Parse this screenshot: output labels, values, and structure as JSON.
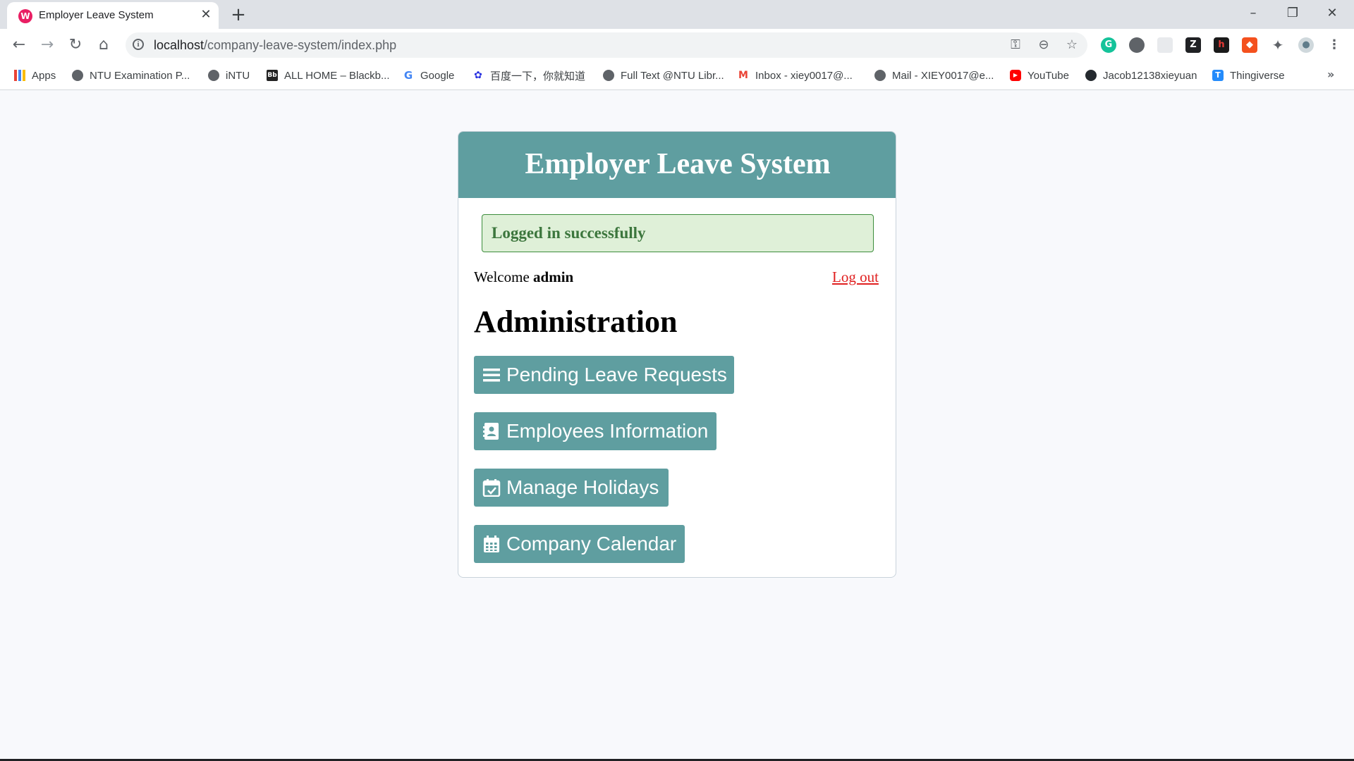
{
  "browser": {
    "tab_title": "Employer Leave System",
    "tab_favicon": "W",
    "url_host": "localhost",
    "url_path": "/company-leave-system/index.php",
    "bookmarks": [
      {
        "label": "Apps",
        "icon": "apps-grid-icon"
      },
      {
        "label": "NTU Examination P...",
        "icon": "globe-icon"
      },
      {
        "label": "iNTU",
        "icon": "globe-icon"
      },
      {
        "label": "ALL HOME – Blackb...",
        "icon": "blackboard-icon"
      },
      {
        "label": "Google",
        "icon": "google-icon"
      },
      {
        "label": "百度一下，你就知道",
        "icon": "baidu-icon"
      },
      {
        "label": "Full Text @NTU Libr...",
        "icon": "globe-icon"
      },
      {
        "label": "Inbox - xiey0017@...",
        "icon": "gmail-icon"
      },
      {
        "label": "Mail - XIEY0017@e...",
        "icon": "globe-icon"
      },
      {
        "label": "YouTube",
        "icon": "youtube-icon"
      },
      {
        "label": "Jacob12138xieyuan",
        "icon": "github-icon"
      },
      {
        "label": "Thingiverse",
        "icon": "thingiverse-icon"
      }
    ],
    "overflow": "»"
  },
  "page": {
    "header_title": "Employer Leave System",
    "alert": "Logged in successfully",
    "welcome_prefix": "Welcome",
    "username": "admin",
    "logout": "Log out",
    "section_title": "Administration",
    "buttons": [
      {
        "label": "Pending Leave Requests",
        "icon": "list-icon"
      },
      {
        "label": "Employees Information",
        "icon": "contact-card-icon"
      },
      {
        "label": "Manage Holidays",
        "icon": "calendar-check-icon"
      },
      {
        "label": "Company Calendar",
        "icon": "calendar-icon"
      }
    ]
  },
  "colors": {
    "header": "#5f9ea0",
    "button": "#5f9ea0",
    "alert_bg": "#dff0d8",
    "alert_text": "#3c763d",
    "logout": "#e02020"
  }
}
